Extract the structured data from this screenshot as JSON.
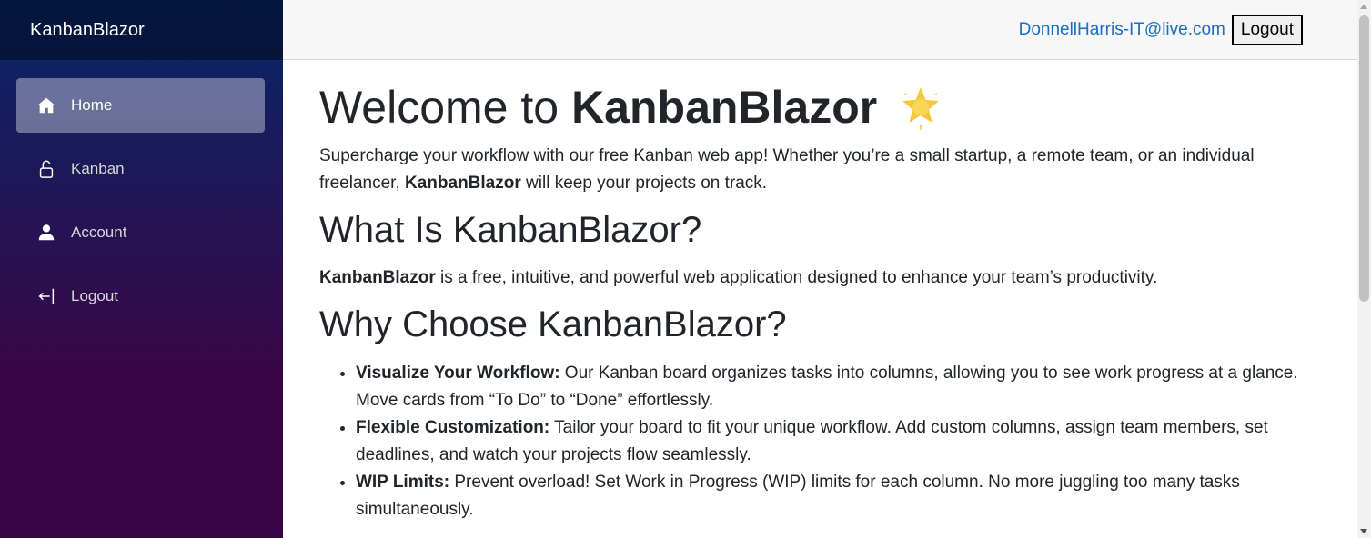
{
  "sidebar": {
    "brand": "KanbanBlazor",
    "items": [
      {
        "label": "Home",
        "icon": "home-icon",
        "active": true
      },
      {
        "label": "Kanban",
        "icon": "lock-icon",
        "active": false
      },
      {
        "label": "Account",
        "icon": "person-icon",
        "active": false
      },
      {
        "label": "Logout",
        "icon": "logout-icon",
        "active": false
      }
    ]
  },
  "header": {
    "email": "DonnellHarris-IT@live.com",
    "logout_label": "Logout"
  },
  "main": {
    "title_prefix": "Welcome to",
    "title_brand": "KanbanBlazor",
    "intro_before": "Supercharge your workflow with our free Kanban web app! Whether you’re a small startup, a remote team, or an individual freelancer, ",
    "intro_brand": "KanbanBlazor",
    "intro_after": " will keep your projects on track.",
    "what_heading": "What Is KanbanBlazor?",
    "what_brand": "KanbanBlazor",
    "what_text": " is a free, intuitive, and powerful web application designed to enhance your team’s productivity.",
    "why_heading": "Why Choose KanbanBlazor?",
    "features": [
      {
        "title": "Visualize Your Workflow:",
        "text": " Our Kanban board organizes tasks into columns, allowing you to see work progress at a glance. Move cards from “To Do” to “Done” effortlessly."
      },
      {
        "title": "Flexible Customization:",
        "text": " Tailor your board to fit your unique workflow. Add custom columns, assign team members, set deadlines, and watch your projects flow seamlessly."
      },
      {
        "title": "WIP Limits:",
        "text": " Prevent overload! Set Work in Progress (WIP) limits for each column. No more juggling too many tasks simultaneously."
      }
    ]
  },
  "colors": {
    "sidebar_top": "#052767",
    "sidebar_bottom": "#3a0647",
    "link": "#1b6ec2",
    "star": "#f6c73b"
  }
}
